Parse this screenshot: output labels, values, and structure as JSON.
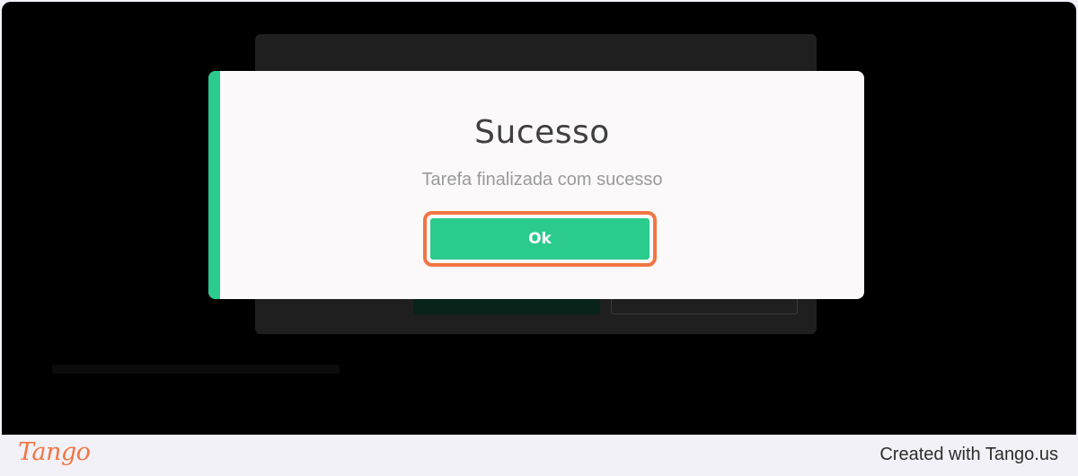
{
  "modal": {
    "title": "Sucesso",
    "message": "Tarefa finalizada com sucesso",
    "ok_label": "Ok"
  },
  "colors": {
    "accent_green": "#2bca8d",
    "highlight_orange": "#f27543",
    "overlay": "#000000"
  },
  "footer": {
    "logo": "Tango",
    "credit": "Created with Tango.us"
  }
}
